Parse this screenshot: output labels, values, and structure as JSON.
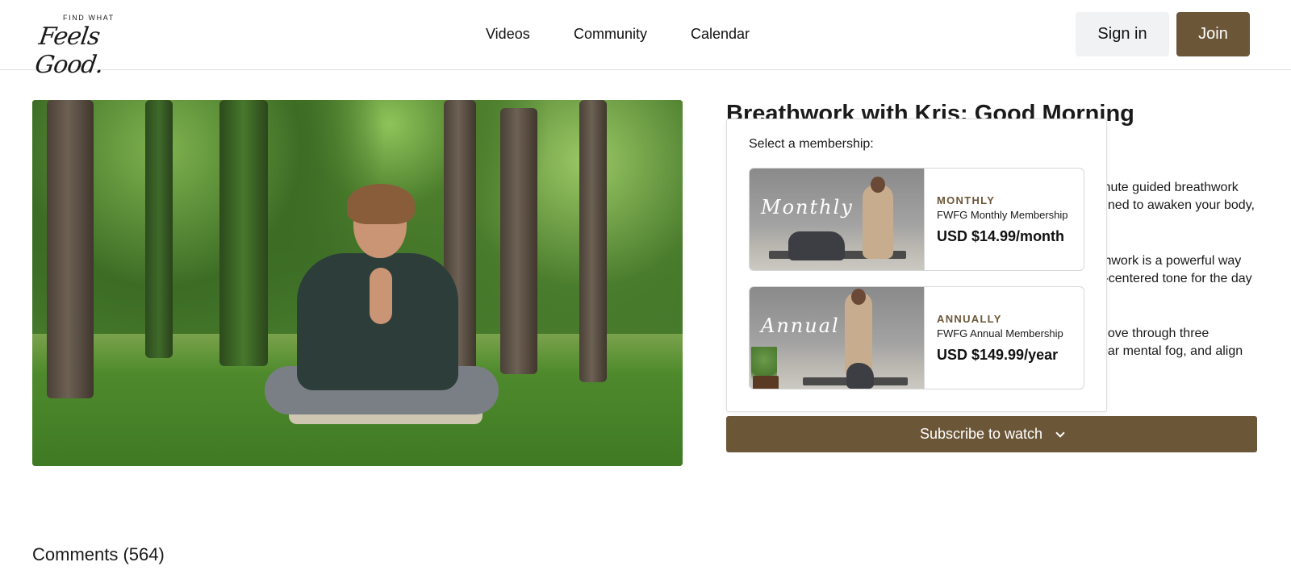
{
  "brand": {
    "tagline": "FIND WHAT",
    "name": "Feels Good."
  },
  "nav": {
    "items": [
      {
        "label": "Videos"
      },
      {
        "label": "Community"
      },
      {
        "label": "Calendar"
      }
    ],
    "sign_in": "Sign in",
    "join": "Join"
  },
  "video": {
    "title": "Breathwork with Kris: Good Morning",
    "description_fragments": [
      "inute guided breathwork",
      "gned to awaken your body,",
      "thwork is a powerful way",
      "t-centered tone for the day",
      "nove through three",
      "ear mental fog, and align"
    ]
  },
  "membership_popup": {
    "label": "Select a membership:",
    "plans": [
      {
        "image_word": "Monthly",
        "frequency": "MONTHLY",
        "name": "FWFG Monthly Membership",
        "price": "USD $14.99/month"
      },
      {
        "image_word": "Annual",
        "frequency": "ANNUALLY",
        "name": "FWFG Annual Membership",
        "price": "USD $149.99/year"
      }
    ]
  },
  "subscribe": {
    "label": "Subscribe to watch",
    "icon": "chevron-down-icon"
  },
  "comments": {
    "label": "Comments (564)"
  },
  "colors": {
    "brand_brown": "#6c5638",
    "signin_bg": "#f1f2f3"
  }
}
